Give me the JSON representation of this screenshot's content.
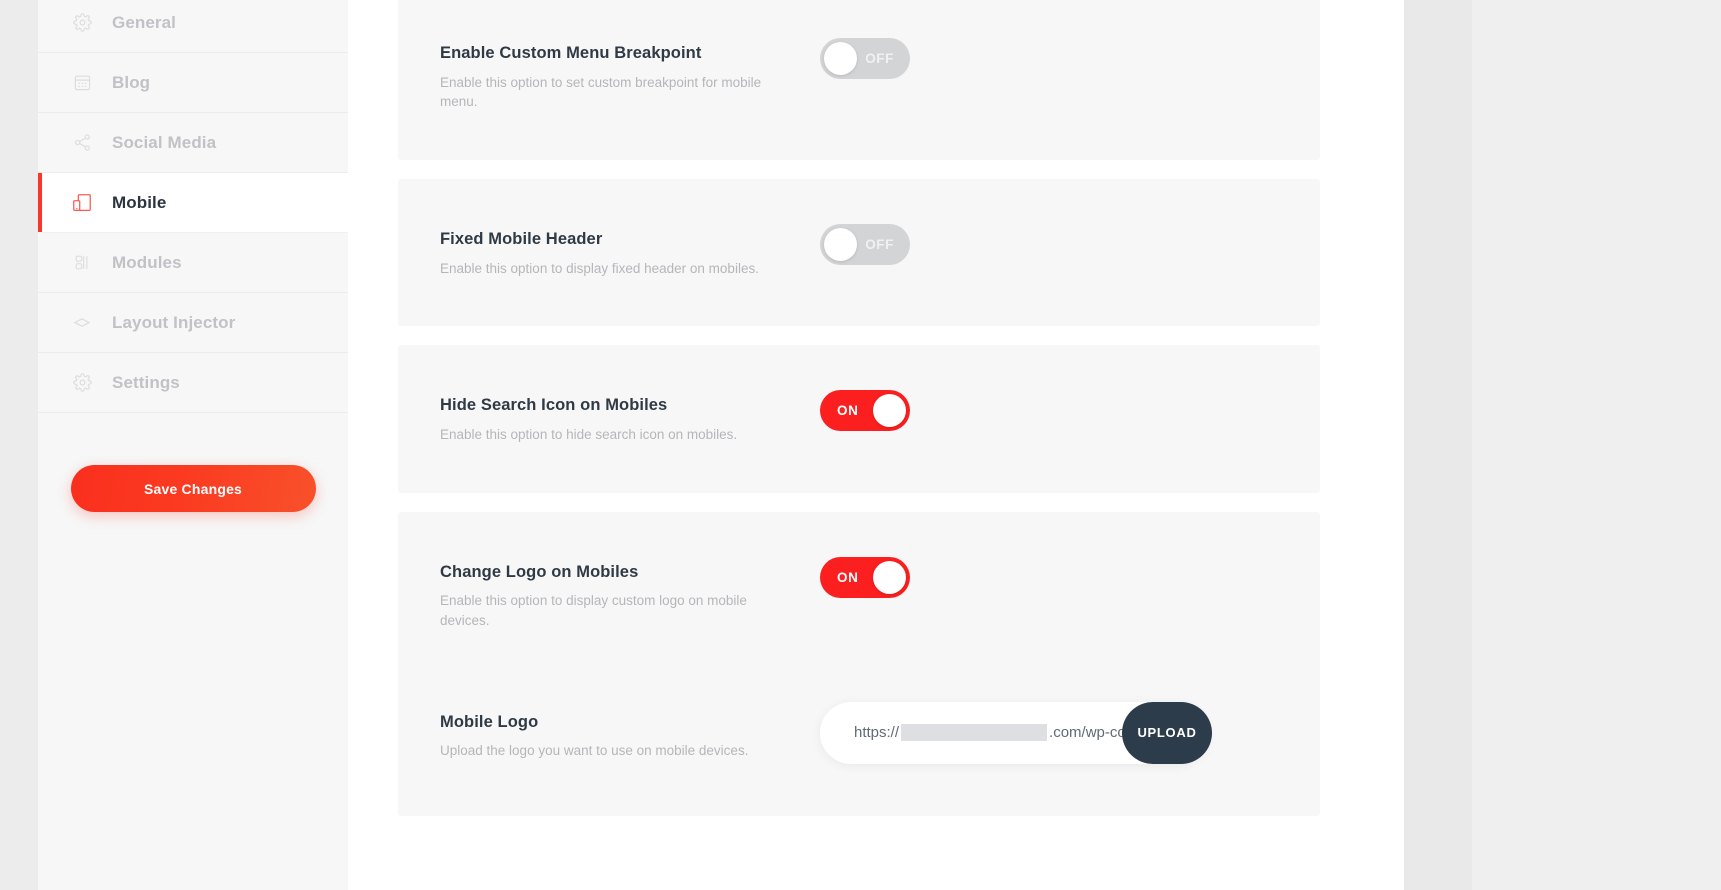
{
  "sidebar": {
    "items": [
      {
        "label": "General",
        "icon": "gear-icon",
        "active": false
      },
      {
        "label": "Blog",
        "icon": "calendar-icon",
        "active": false
      },
      {
        "label": "Social Media",
        "icon": "share-icon",
        "active": false
      },
      {
        "label": "Mobile",
        "icon": "mobile-device-icon",
        "active": true
      },
      {
        "label": "Modules",
        "icon": "modules-icon",
        "active": false
      },
      {
        "label": "Layout Injector",
        "icon": "layers-icon",
        "active": false
      },
      {
        "label": "Settings",
        "icon": "gear-icon",
        "active": false
      }
    ],
    "save_label": "Save Changes",
    "accent_color": "#f8362b",
    "active_text_color": "#2b3440",
    "inactive_text_color": "#c2c2c6"
  },
  "settings": {
    "cards": [
      {
        "title": "Enable Custom Menu Breakpoint",
        "description": "Enable this option to set custom breakpoint for mobile menu.",
        "toggle": {
          "state": "off",
          "label": "OFF"
        }
      },
      {
        "title": "Fixed Mobile Header",
        "description": "Enable this option to display fixed header on mobiles.",
        "toggle": {
          "state": "off",
          "label": "OFF"
        }
      },
      {
        "title": "Hide Search Icon on Mobiles",
        "description": "Enable this option to hide search icon on mobiles.",
        "toggle": {
          "state": "on",
          "label": "ON"
        }
      },
      {
        "title": "Change Logo on Mobiles",
        "description": "Enable this option to display custom logo on mobile devices.",
        "toggle": {
          "state": "on",
          "label": "ON"
        }
      }
    ],
    "logo_row": {
      "title": "Mobile Logo",
      "description": "Upload the logo you want to use on mobile devices.",
      "url_prefix": "https://",
      "url_suffix": ".com/wp-con",
      "upload_label": "UPLOAD",
      "upload_button_color": "#2d3c4a"
    },
    "toggle_on_color": "#fb1f1f",
    "toggle_off_color": "#d3d4d6"
  }
}
